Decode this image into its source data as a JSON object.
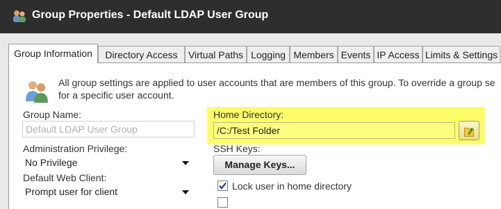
{
  "window": {
    "title": "Group Properties - Default LDAP User Group",
    "icon": "group-users-icon"
  },
  "tabs": [
    {
      "label": "Group Information",
      "active": true
    },
    {
      "label": "Directory Access"
    },
    {
      "label": "Virtual Paths"
    },
    {
      "label": "Logging"
    },
    {
      "label": "Members"
    },
    {
      "label": "Events"
    },
    {
      "label": "IP Access"
    },
    {
      "label": "Limits & Settings"
    }
  ],
  "info": {
    "icon": "user-group-icon",
    "line1": "All group settings are applied to user accounts that are members of this group. To override a group se",
    "line2": "for a specific user account."
  },
  "form": {
    "group_name_label": "Group Name:",
    "group_name_value": "Default LDAP User Group",
    "admin_privilege_label": "Administration Privilege:",
    "admin_privilege_value": "No Privilege",
    "web_client_label": "Default Web Client:",
    "web_client_value": "Prompt user for client",
    "home_directory_label": "Home Directory:",
    "home_directory_value": "/C:/Test Folder",
    "ssh_keys_label": "SSH Keys:",
    "manage_keys_label": "Manage Keys...",
    "lock_home_label": "Lock user in home directory",
    "lock_home_checked": true
  },
  "colors": {
    "highlight": "#fdfd6a",
    "titlebar": "#2e2e2e"
  }
}
